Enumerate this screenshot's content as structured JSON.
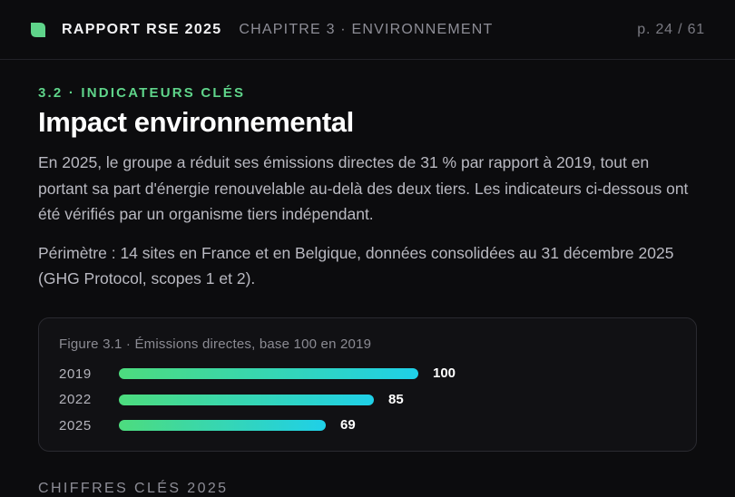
{
  "header": {
    "brand": "RAPPORT RSE 2025",
    "chapter": "CHAPITRE 3 · ENVIRONNEMENT",
    "pager": "p. 24 / 61",
    "accent": "#5fd48a"
  },
  "section": {
    "eyebrow": "3.2 · INDICATEURS CLÉS",
    "title": "Impact environnemental",
    "paragraph1": "En 2025, le groupe a réduit ses émissions directes de 31 % par rapport à 2019, tout en portant sa part d'énergie renouvelable au-delà des deux tiers. Les indicateurs ci-dessous ont été vérifiés par un organisme tiers indépendant.",
    "paragraph2": "Périmètre : 14 sites en France et en Belgique, données consolidées au 31 décembre 2025 (GHG Protocol, scopes 1 et 2)."
  },
  "figure": {
    "caption": "Figure 3.1 · Émissions directes, base 100 en 2019"
  },
  "chart_data": {
    "type": "bar",
    "orientation": "horizontal",
    "categories": [
      "2019",
      "2022",
      "2025"
    ],
    "values": [
      100,
      85,
      69
    ],
    "title": "Figure 3.1 · Émissions directes, base 100 en 2019",
    "xlim": [
      0,
      100
    ],
    "grid": false,
    "bar_color_start": "#4ddc7e",
    "bar_color_end": "#1fd0e8"
  },
  "next_section": {
    "heading": "CHIFFRES CLÉS 2025"
  }
}
